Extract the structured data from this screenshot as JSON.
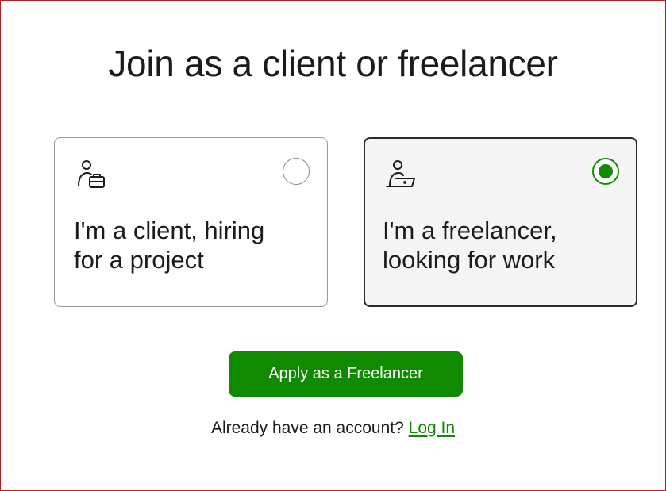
{
  "page": {
    "title": "Join as a client or freelancer"
  },
  "roles": [
    {
      "id": "client",
      "label_line1": "I'm a client, hiring",
      "label_line2": "for a project",
      "icon": "client-briefcase-icon",
      "selected": false
    },
    {
      "id": "freelancer",
      "label_line1": "I'm a freelancer,",
      "label_line2": "looking for work",
      "icon": "freelancer-laptop-icon",
      "selected": true
    }
  ],
  "actions": {
    "apply_label": "Apply as a Freelancer"
  },
  "login": {
    "prompt": "Already have an account?",
    "link_label": "Log In"
  },
  "colors": {
    "accent": "#108a00",
    "text": "#1b1b1b",
    "selected_card_bg": "#f5f5f5",
    "frame_border": "#b91c1c"
  }
}
